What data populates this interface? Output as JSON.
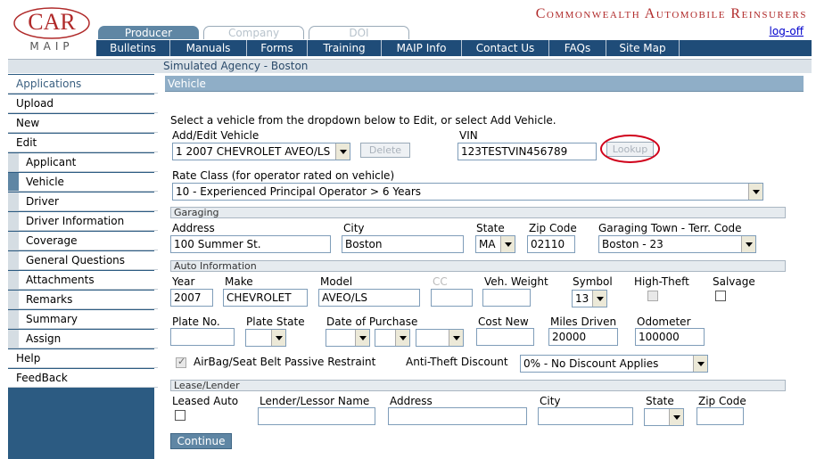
{
  "header": {
    "logo_top": "CAR",
    "logo_bottom": "MAIP",
    "org_title": "Commonwealth Automobile Reinsurers",
    "logoff": "log-off",
    "tabs": [
      "Producer",
      "Company",
      "DOI"
    ]
  },
  "nav": [
    "Bulletins",
    "Manuals",
    "Forms",
    "Training",
    "MAIP Info",
    "Contact Us",
    "FAQs",
    "Site Map"
  ],
  "agency": "Simulated Agency - Boston",
  "sidebar": {
    "items": [
      "Applications",
      "Upload",
      "New",
      "Edit"
    ],
    "sub_items": [
      "Applicant",
      "Vehicle",
      "Driver",
      "Driver Information",
      "Coverage",
      "General Questions",
      "Attachments",
      "Remarks",
      "Summary",
      "Assign"
    ],
    "bottom_items": [
      "Help",
      "FeedBack"
    ]
  },
  "page": {
    "title": "Vehicle",
    "instructions": "Select a vehicle from the dropdown below to Edit, or select Add Vehicle.",
    "add_edit_label": "Add/Edit Vehicle",
    "vehicle_selected": "1   2007 CHEVROLET AVEO/LS",
    "delete_label": "Delete",
    "vin_label": "VIN",
    "vin_value": "123TESTVIN456789",
    "lookup_label": "Lookup",
    "rate_class_label": "Rate Class (for operator rated on vehicle)",
    "rate_class_value": "10 - Experienced Principal Operator > 6 Years"
  },
  "garaging": {
    "section": "Garaging",
    "address_label": "Address",
    "address": "100 Summer St.",
    "city_label": "City",
    "city": "Boston",
    "state_label": "State",
    "state": "MA",
    "zip_label": "Zip Code",
    "zip": "02110",
    "town_label": "Garaging Town - Terr. Code",
    "town": "Boston - 23"
  },
  "auto": {
    "section": "Auto Information",
    "year_label": "Year",
    "year": "2007",
    "make_label": "Make",
    "make": "CHEVROLET",
    "model_label": "Model",
    "model": "AVEO/LS",
    "cc_label": "CC",
    "weight_label": "Veh. Weight",
    "symbol_label": "Symbol",
    "symbol": "13",
    "hightheft_label": "High-Theft",
    "salvage_label": "Salvage",
    "plate_label": "Plate No.",
    "plate_state_label": "Plate State",
    "purchase_label": "Date of Purchase",
    "cost_label": "Cost New",
    "miles_label": "Miles Driven",
    "miles": "20000",
    "odometer_label": "Odometer",
    "odometer": "100000",
    "airbag_label": "AirBag/Seat Belt Passive Restraint",
    "antitheft_label": "Anti-Theft Discount",
    "antitheft_value": "0% - No Discount Applies"
  },
  "lease": {
    "section": "Lease/Lender",
    "leased_label": "Leased Auto",
    "lender_label": "Lender/Lessor Name",
    "address_label": "Address",
    "city_label": "City",
    "state_label": "State",
    "zip_label": "Zip Code"
  },
  "continue_label": "Continue"
}
